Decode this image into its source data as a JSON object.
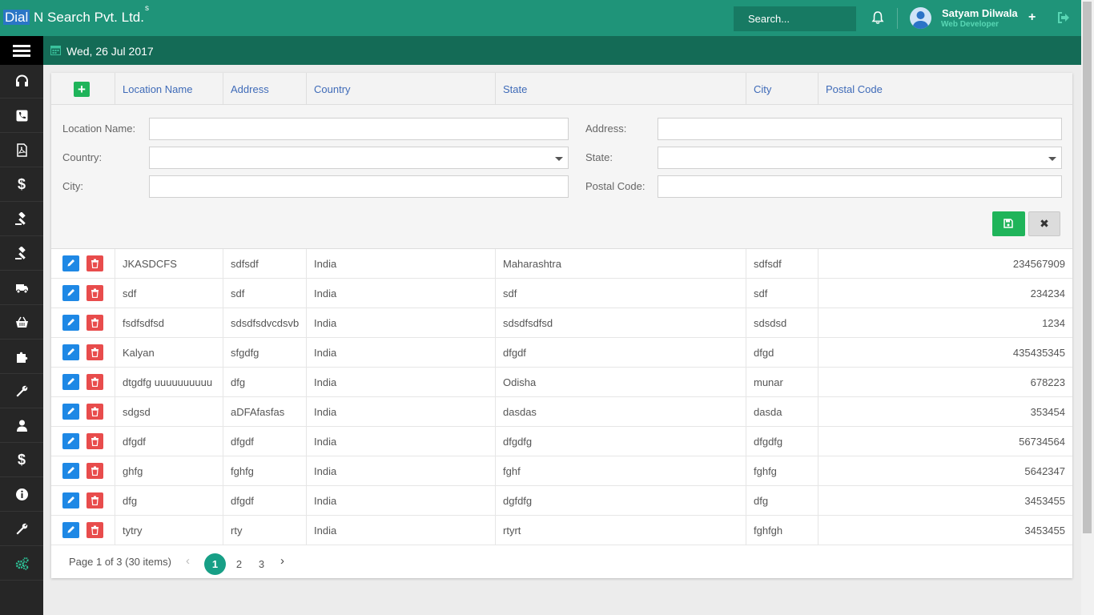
{
  "header": {
    "brand_prefix": "Dial",
    "brand_rest": " N Search Pvt. Ltd.",
    "brand_sup": "s",
    "search_placeholder": "Search...",
    "user_name": "Satyam Dilwala",
    "user_role": "Web Developer",
    "plus_label": "+"
  },
  "subheader": {
    "date": "Wed, 26 Jul 2017"
  },
  "sidebar": {
    "items": [
      {
        "icon": "headset-icon"
      },
      {
        "icon": "phone-icon"
      },
      {
        "icon": "pdf-icon"
      },
      {
        "icon": "dollar-icon",
        "label": "$"
      },
      {
        "icon": "gavel-icon"
      },
      {
        "icon": "gavel-icon"
      },
      {
        "icon": "truck-icon"
      },
      {
        "icon": "basket-icon"
      },
      {
        "icon": "puzzle-icon"
      },
      {
        "icon": "wrench-icon"
      },
      {
        "icon": "user-icon"
      },
      {
        "icon": "dollar-icon",
        "label": "$"
      },
      {
        "icon": "info-icon",
        "label": "i"
      },
      {
        "icon": "wrench-icon"
      },
      {
        "icon": "cogs-icon"
      }
    ]
  },
  "table": {
    "columns": [
      "Location Name",
      "Address",
      "Country",
      "State",
      "City",
      "Postal Code"
    ],
    "rows": [
      [
        "JKASDCFS",
        "sdfsdf",
        "India",
        "Maharashtra",
        "sdfsdf",
        "234567909"
      ],
      [
        "sdf",
        "sdf",
        "India",
        "sdf",
        "sdf",
        "234234"
      ],
      [
        "fsdfsdfsd",
        "sdsdfsdvcdsvb",
        "India",
        "sdsdfsdfsd",
        "sdsdsd",
        "1234"
      ],
      [
        "Kalyan",
        "sfgdfg",
        "India",
        "dfgdf",
        "dfgd",
        "435435345"
      ],
      [
        "dtgdfg uuuuuuuuuu",
        "dfg",
        "India",
        "Odisha",
        "munar",
        "678223"
      ],
      [
        "sdgsd",
        "aDFAfasfas",
        "India",
        "dasdas",
        "dasda",
        "353454"
      ],
      [
        "dfgdf",
        "dfgdf",
        "India",
        "dfgdfg",
        "dfgdfg",
        "56734564"
      ],
      [
        "ghfg",
        "fghfg",
        "India",
        "fghf",
        "fghfg",
        "5642347"
      ],
      [
        "dfg",
        "dfgdf",
        "India",
        "dgfdfg",
        "dfg",
        "3453455"
      ],
      [
        "tytry",
        "rty",
        "India",
        "rtyrt",
        "fghfgh",
        "3453455"
      ]
    ]
  },
  "form": {
    "location_name_label": "Location Name:",
    "address_label": "Address:",
    "country_label": "Country:",
    "state_label": "State:",
    "city_label": "City:",
    "postal_code_label": "Postal Code:",
    "location_name_value": "",
    "address_value": "",
    "country_value": "",
    "state_value": "",
    "city_value": "",
    "postal_code_value": "",
    "cancel_label": "✖"
  },
  "pagination": {
    "info": "Page 1 of 3 (30 items)",
    "pages": [
      "1",
      "2",
      "3"
    ],
    "current": "1",
    "prev": "‹",
    "next": "›"
  },
  "colors": {
    "topbar": "#1f9479",
    "subbar": "#146b56",
    "sidebar": "#262626",
    "header_text": "#3f6bb8",
    "add_button": "#1fb45a",
    "edit_button": "#1e88e5",
    "delete_button": "#e84c4c",
    "active_page": "#179f86"
  }
}
